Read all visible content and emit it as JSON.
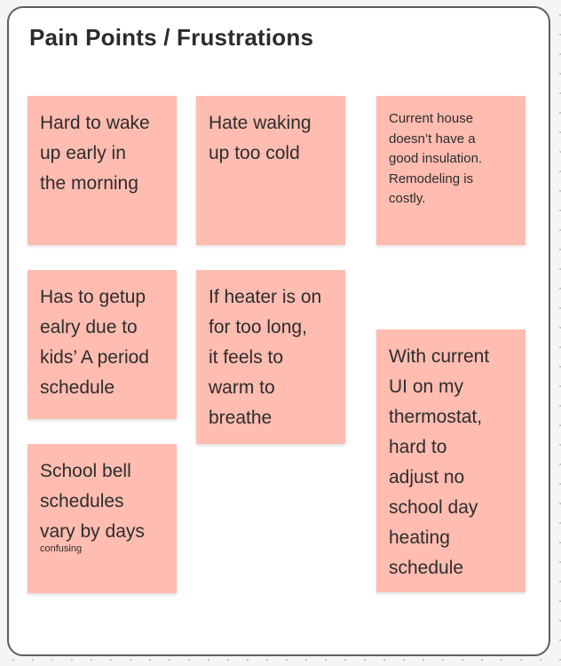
{
  "board": {
    "title": "Pain Points / Frustrations"
  },
  "notes": [
    {
      "text": "Hard to wake\nup early in\nthe morning"
    },
    {
      "text": "Hate waking\nup too cold"
    },
    {
      "text": "Current house\ndoesn’t have a\ngood insulation.\nRemodeling  is\ncostly."
    },
    {
      "text": "Has to getup\nealry due to\nkids’ A period\nschedule"
    },
    {
      "text": "If heater is on\nfor too long,\nit feels to\nwarm to\nbreathe"
    },
    {
      "text": "With current\nUI on my\nthermostat,\nhard to\nadjust no\nschool day\nheating\nschedule"
    },
    {
      "text": "School bell\nschedules\nvary by days",
      "note": "confusing"
    }
  ],
  "colors": {
    "sticky": "#ffbcb0",
    "frame_border": "#5e5e5e",
    "text": "#2d2d2d"
  }
}
